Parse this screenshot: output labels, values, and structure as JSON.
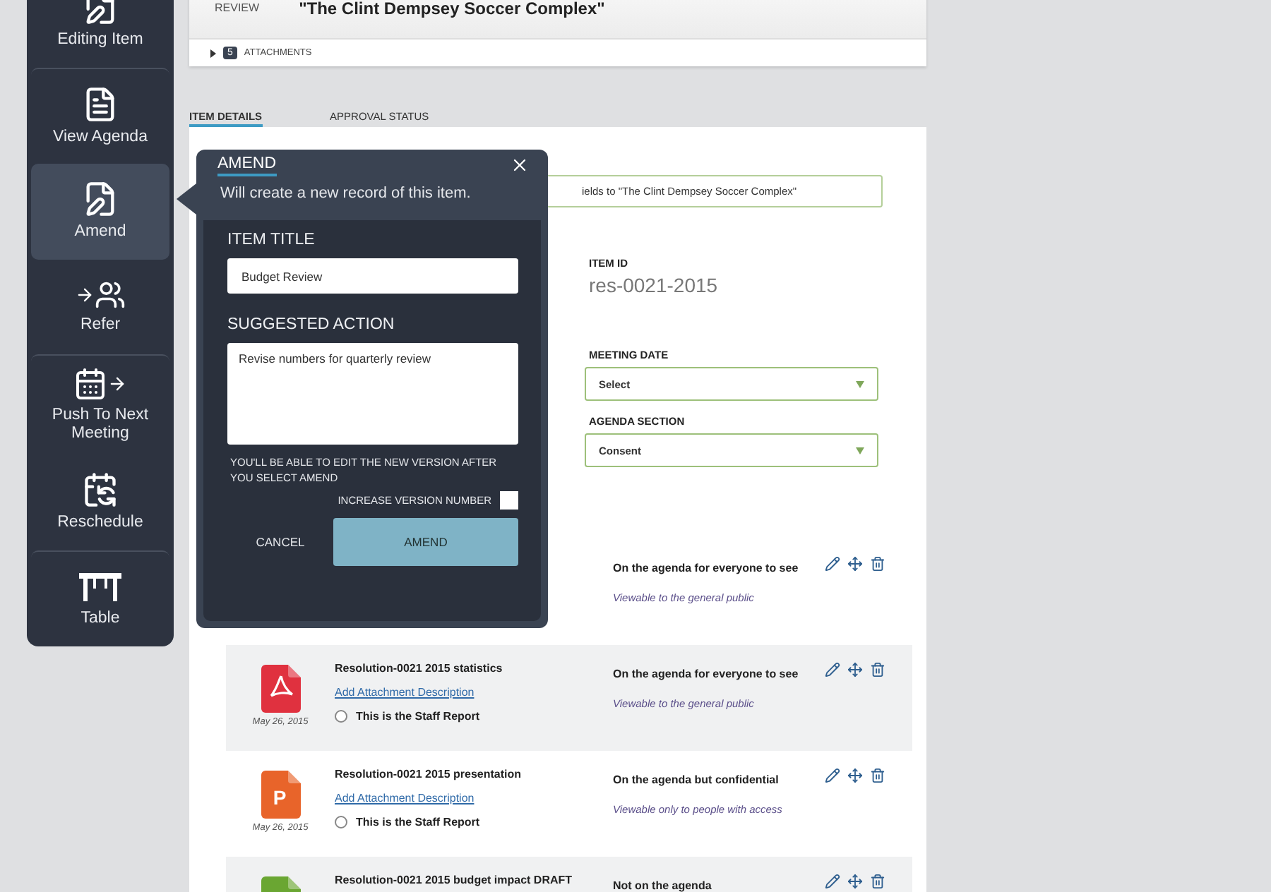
{
  "sidebar": {
    "items": [
      {
        "kind": "edit",
        "label": "Editing Item",
        "selected": false,
        "separated": false
      },
      {
        "kind": "agenda",
        "label": "View Agenda",
        "selected": false,
        "separated": true
      },
      {
        "kind": "amend",
        "label": "Amend",
        "selected": true,
        "separated": false
      },
      {
        "kind": "refer",
        "label": "Refer",
        "selected": false,
        "separated": false
      },
      {
        "kind": "push",
        "label": "Push To Next Meeting",
        "selected": false,
        "separated": true
      },
      {
        "kind": "reschedule",
        "label": "Reschedule",
        "selected": false,
        "separated": false
      },
      {
        "kind": "table",
        "label": "Table",
        "selected": false,
        "separated": true
      }
    ]
  },
  "summary": {
    "label": "REVIEW",
    "title": "\"The Clint Dempsey Soccer Complex\"",
    "attachments_count": "5",
    "attachments_label": "ATTACHMENTS",
    "expanded": false
  },
  "tabs": [
    {
      "label": "ITEM DETAILS",
      "selected": true
    },
    {
      "label": "APPROVAL STATUS",
      "selected": false
    }
  ],
  "details": {
    "title_field": "ields to \"The Clint Dempsey Soccer Complex\"",
    "item_id_label": "ITEM ID",
    "item_id": "res-0021-2015",
    "meeting_date": {
      "label": "MEETING DATE",
      "value": "Select"
    },
    "agenda_section": {
      "label": "AGENDA SECTION",
      "value": "Consent"
    }
  },
  "attachments": [
    {
      "visibility": "On the agenda for everyone to see",
      "note": "Viewable to the general public"
    },
    {
      "kind": "pdf",
      "date": "May 26, 2015",
      "title": "Resolution-0021 2015 statistics",
      "link": "Add Attachment Description",
      "staff_report": {
        "label": "This is the Staff Report",
        "selected": false
      },
      "visibility": "On the agenda for everyone to see",
      "note": "Viewable to the general public"
    },
    {
      "kind": "ppt",
      "letter": "P",
      "date": "May 26, 2015",
      "title": "Resolution-0021 2015 presentation",
      "link": "Add Attachment Description",
      "staff_report": {
        "label": "This is the Staff Report",
        "selected": false
      },
      "visibility": "On the agenda but confidential",
      "note": "Viewable only to people with access"
    },
    {
      "kind": "xls",
      "title": "Resolution-0021 2015 budget impact DRAFT",
      "visibility": "Not on the agenda"
    }
  ],
  "popover": {
    "title": "AMEND",
    "subtitle": "Will create a new record of this item.",
    "item_title_label": "ITEM TITLE",
    "item_title": "Budget Review",
    "action_label": "SUGGESTED ACTION",
    "action": "Revise numbers for quarterly review",
    "note": "YOU'LL BE ABLE TO EDIT THE NEW VERSION AFTER YOU SELECT AMEND",
    "version_label": "INCREASE VERSION NUMBER",
    "version_checked": false,
    "cancel": "CANCEL",
    "submit": "AMEND"
  }
}
